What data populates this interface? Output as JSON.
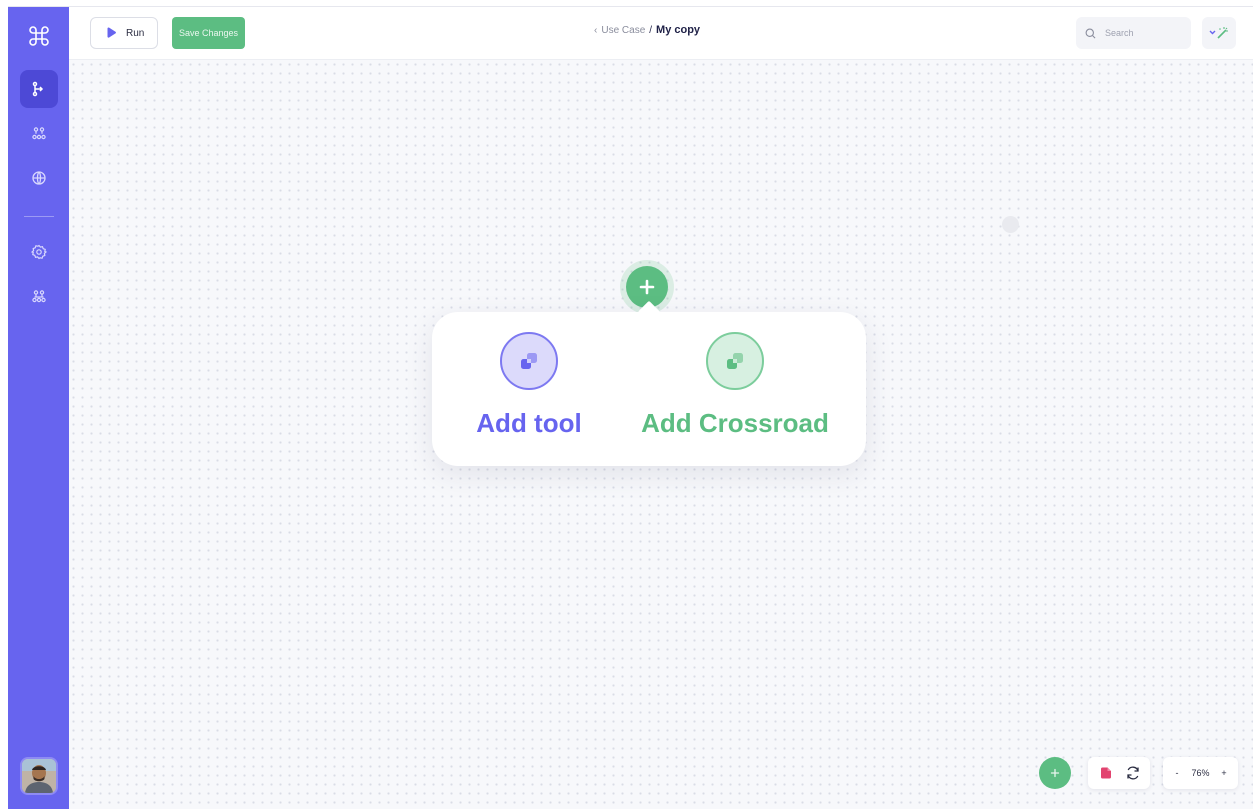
{
  "toolbar": {
    "run_label": "Run",
    "save_label": "Save Changes"
  },
  "breadcrumb": {
    "parent": "Use Case",
    "separator": "/",
    "current": "My copy"
  },
  "search": {
    "placeholder": "Search"
  },
  "sidebar": {
    "items": [
      {
        "icon": "flow-icon",
        "active": true
      },
      {
        "icon": "hierarchy-icon",
        "active": false
      },
      {
        "icon": "globe-icon",
        "active": false
      },
      {
        "icon": "gear-icon",
        "active": false
      },
      {
        "icon": "team-icon",
        "active": false
      }
    ]
  },
  "popup": {
    "add_tool_label": "Add tool",
    "add_crossroad_label": "Add Crossroad"
  },
  "zoom": {
    "minus": "-",
    "level": "76%",
    "plus": "+"
  },
  "colors": {
    "sidebar": "#6764ef",
    "accent_purple": "#6764ef",
    "accent_green": "#5cbd82",
    "danger_pink": "#e2436f"
  }
}
